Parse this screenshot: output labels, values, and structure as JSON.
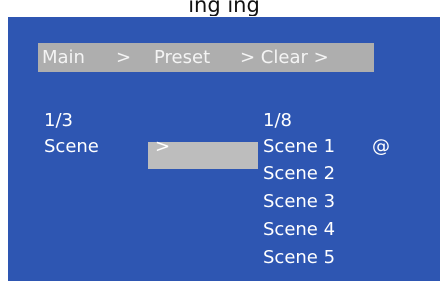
{
  "top_text": "ing ing",
  "breadcrumb": {
    "main": "Main",
    "sep1": ">",
    "preset": "Preset",
    "sep2": "> Clear >"
  },
  "left_panel": {
    "page": "1/3",
    "label": "Scene",
    "arrow": ">"
  },
  "right_panel": {
    "page": "1/8",
    "items": [
      "Scene 1",
      "Scene 2",
      "Scene 3",
      "Scene 4",
      "Scene 5"
    ],
    "marker": "@"
  },
  "colors": {
    "screen_bg": "#2e56b2",
    "bar_bg": "#aeaeae",
    "selection_bg": "#bdbdbd",
    "text": "#ffffff"
  }
}
